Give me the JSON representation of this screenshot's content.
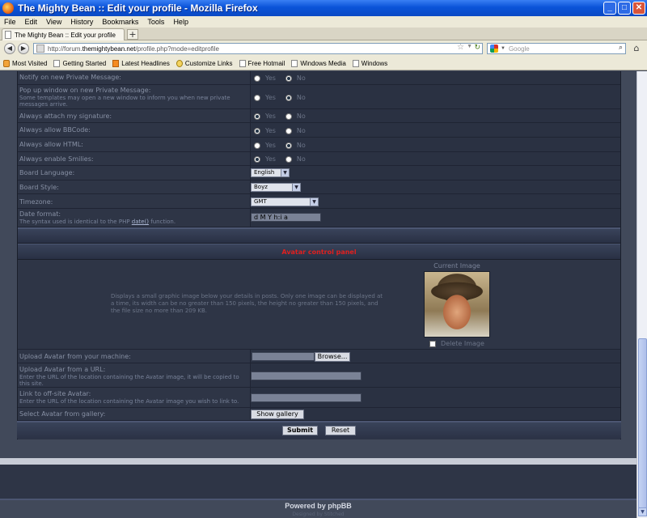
{
  "window": {
    "title": "The Mighty Bean :: Edit your profile - Mozilla Firefox",
    "min": "_",
    "max": "□",
    "close": "✕"
  },
  "menu": [
    "File",
    "Edit",
    "View",
    "History",
    "Bookmarks",
    "Tools",
    "Help"
  ],
  "tab": {
    "label": "The Mighty Bean :: Edit your profile",
    "new_tab": "+"
  },
  "nav": {
    "back": "◀",
    "forward": "▶",
    "url_prefix": "http://forum.",
    "url_host": "themightybean.net",
    "url_path": "/profile.php?mode=editprofile",
    "search_placeholder": "Google",
    "home": "⌂"
  },
  "bookmarks": [
    "Most Visited",
    "Getting Started",
    "Latest Headlines",
    "Customize Links",
    "Free Hotmail",
    "Windows Media",
    "Windows"
  ],
  "prefs": {
    "yes": "Yes",
    "no": "No",
    "rows": [
      {
        "label": "Notify on new Private Message:",
        "sub": "",
        "value": "No"
      },
      {
        "label": "Pop up window on new Private Message:",
        "sub": "Some templates may open a new window to inform you when new private messages arrive.",
        "value": "No"
      },
      {
        "label": "Always attach my signature:",
        "sub": "",
        "value": "Yes"
      },
      {
        "label": "Always allow BBCode:",
        "sub": "",
        "value": "Yes"
      },
      {
        "label": "Always allow HTML:",
        "sub": "",
        "value": "No"
      },
      {
        "label": "Always enable Smilies:",
        "sub": "",
        "value": "Yes"
      }
    ],
    "language_label": "Board Language:",
    "language_value": "English",
    "style_label": "Board Style:",
    "style_value": "Boyz",
    "timezone_label": "Timezone:",
    "timezone_value": "GMT",
    "date_label": "Date format:",
    "date_sub_prefix": "The syntax used is identical to the PHP ",
    "date_sub_link": "date()",
    "date_sub_suffix": " function.",
    "date_value": "d M Y h:i a"
  },
  "avatar": {
    "title": "Avatar control panel",
    "description": "Displays a small graphic image below your details in posts. Only one image can be displayed at a time, its width can be no greater than 150 pixels, the height no greater than 150 pixels, and the file size no more than 209 KB.",
    "current_image": "Current Image",
    "delete_image": "Delete Image",
    "upload_machine": "Upload Avatar from your machine:",
    "browse": "Browse...",
    "upload_url": "Upload Avatar from a URL:",
    "upload_url_sub": "Enter the URL of the location containing the Avatar image, it will be copied to this site.",
    "offsite": "Link to off-site Avatar:",
    "offsite_sub": "Enter the URL of the location containing the Avatar image you wish to link to.",
    "gallery": "Select Avatar from gallery:",
    "show_gallery": "Show gallery"
  },
  "actions": {
    "submit": "Submit",
    "reset": "Reset"
  },
  "footer": {
    "powered": "Powered by phpBB",
    "designed": "Designed by Stitched"
  }
}
